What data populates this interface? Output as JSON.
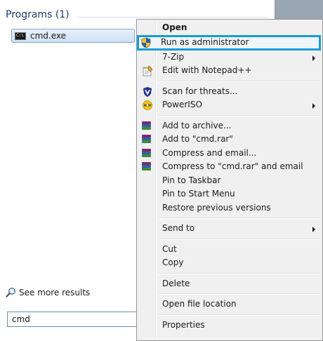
{
  "start_menu": {
    "programs_header": "Programs (1)",
    "results": [
      {
        "label": "cmd.exe",
        "icon": "cmd-icon"
      }
    ],
    "see_more_label": "See more results",
    "search": {
      "value": "cmd"
    }
  },
  "context_menu": {
    "items": {
      "open": "Open",
      "run_as_admin": "Run as administrator",
      "seven_zip": "7-Zip",
      "edit_notepad": "Edit with Notepad++",
      "scan_threats": "Scan for threats...",
      "poweriso": "PowerISO",
      "add_archive": "Add to archive...",
      "add_cmd_rar": "Add to \"cmd.rar\"",
      "compress_email": "Compress and email...",
      "compress_cmd_email": "Compress to \"cmd.rar\" and email",
      "pin_taskbar": "Pin to Taskbar",
      "pin_start": "Pin to Start Menu",
      "restore_versions": "Restore previous versions",
      "send_to": "Send to",
      "cut": "Cut",
      "copy": "Copy",
      "delete": "Delete",
      "open_location": "Open file location",
      "properties": "Properties"
    },
    "highlight_color": "#1a9ad6"
  }
}
